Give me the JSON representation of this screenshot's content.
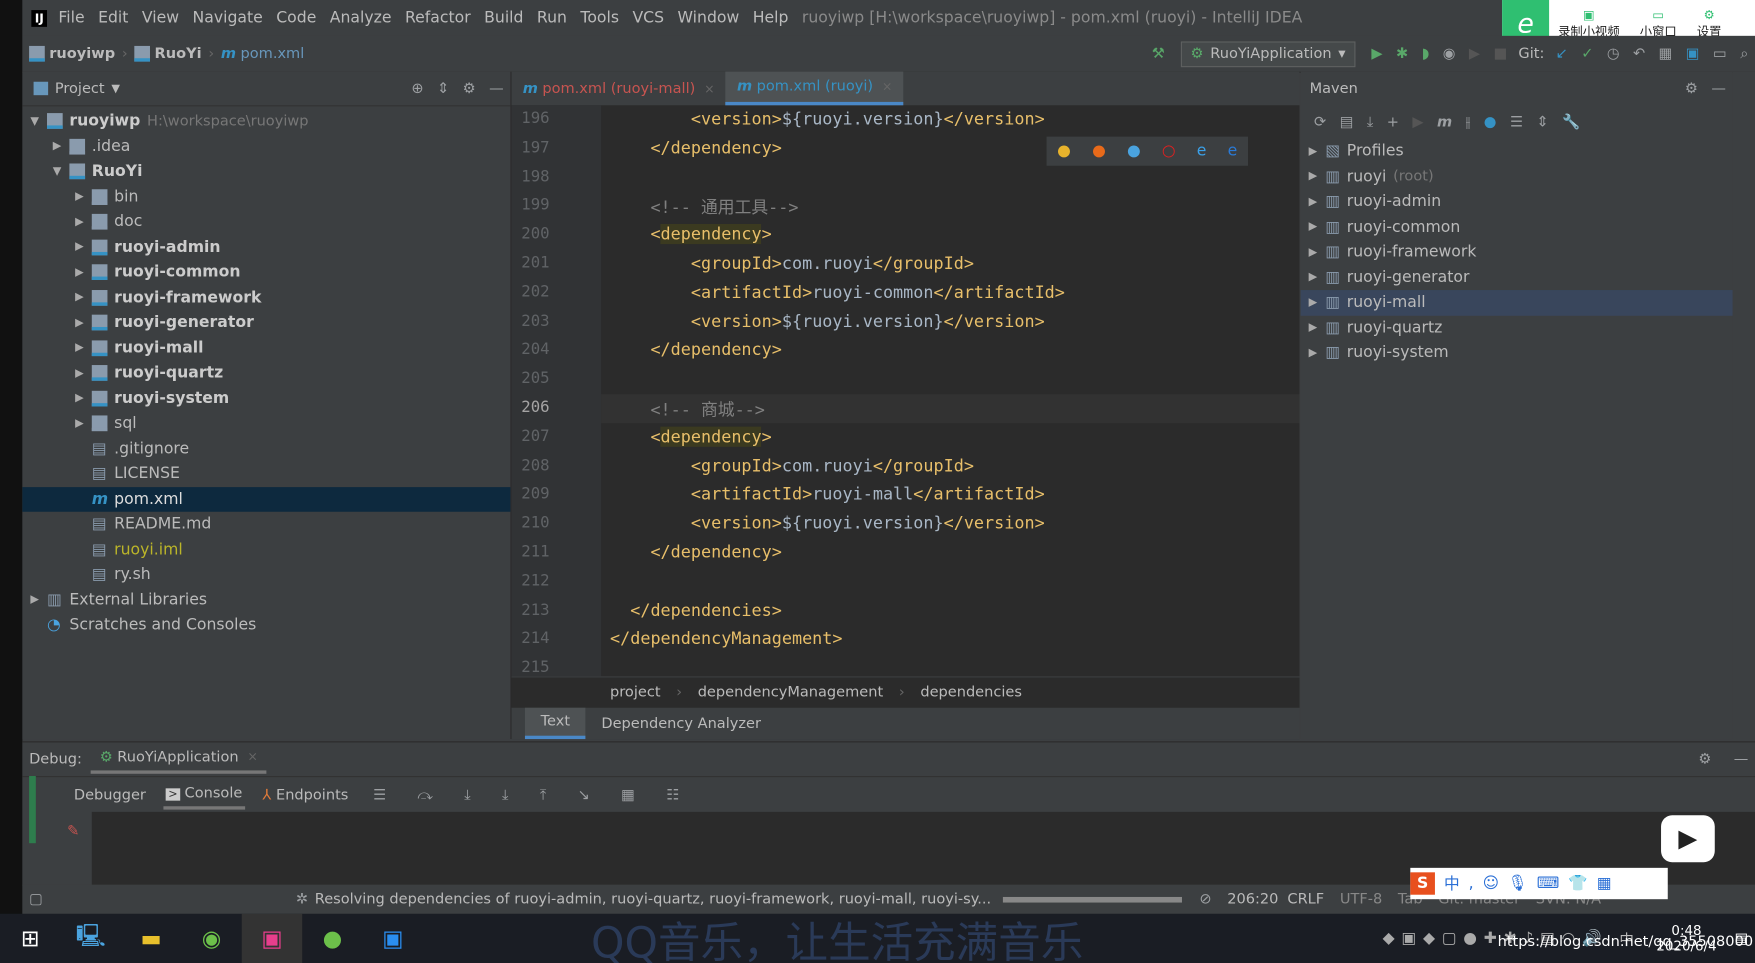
{
  "menubar": {
    "items": [
      "File",
      "Edit",
      "View",
      "Navigate",
      "Code",
      "Analyze",
      "Refactor",
      "Build",
      "Run",
      "Tools",
      "VCS",
      "Window",
      "Help"
    ],
    "title": "ruoyiwp [H:\\workspace\\ruoyiwp] - pom.xml (ruoyi) - IntelliJ IDEA"
  },
  "overlay": {
    "record": "录制小视频",
    "mini": "小窗口",
    "settings": "设置"
  },
  "navbar": {
    "crumbs": [
      "ruoyiwp",
      "RuoYi",
      "pom.xml"
    ],
    "run_config": "RuoYiApplication",
    "git": "Git:"
  },
  "project": {
    "title": "Project",
    "tree": [
      {
        "label": "ruoyiwp",
        "hint": "H:\\workspace\\ruoyiwp",
        "depth": 0,
        "arrow": "down",
        "type": "module",
        "bold": true
      },
      {
        "label": ".idea",
        "depth": 1,
        "arrow": "right",
        "type": "folder"
      },
      {
        "label": "RuoYi",
        "depth": 1,
        "arrow": "down",
        "type": "module",
        "bold": true
      },
      {
        "label": "bin",
        "depth": 2,
        "arrow": "right",
        "type": "folder"
      },
      {
        "label": "doc",
        "depth": 2,
        "arrow": "right",
        "type": "folder"
      },
      {
        "label": "ruoyi-admin",
        "depth": 2,
        "arrow": "right",
        "type": "module",
        "bold": true
      },
      {
        "label": "ruoyi-common",
        "depth": 2,
        "arrow": "right",
        "type": "module",
        "bold": true
      },
      {
        "label": "ruoyi-framework",
        "depth": 2,
        "arrow": "right",
        "type": "module",
        "bold": true
      },
      {
        "label": "ruoyi-generator",
        "depth": 2,
        "arrow": "right",
        "type": "module",
        "bold": true
      },
      {
        "label": "ruoyi-mall",
        "depth": 2,
        "arrow": "right",
        "type": "module",
        "bold": true
      },
      {
        "label": "ruoyi-quartz",
        "depth": 2,
        "arrow": "right",
        "type": "module",
        "bold": true
      },
      {
        "label": "ruoyi-system",
        "depth": 2,
        "arrow": "right",
        "type": "module",
        "bold": true
      },
      {
        "label": "sql",
        "depth": 2,
        "arrow": "right",
        "type": "folder"
      },
      {
        "label": ".gitignore",
        "depth": 2,
        "type": "file"
      },
      {
        "label": "LICENSE",
        "depth": 2,
        "type": "file"
      },
      {
        "label": "pom.xml",
        "depth": 2,
        "type": "maven",
        "selected": true
      },
      {
        "label": "README.md",
        "depth": 2,
        "type": "file"
      },
      {
        "label": "ruoyi.iml",
        "depth": 2,
        "type": "file",
        "color": "#bbb529"
      },
      {
        "label": "ry.sh",
        "depth": 2,
        "type": "file"
      },
      {
        "label": "External Libraries",
        "depth": 0,
        "arrow": "right",
        "type": "lib"
      },
      {
        "label": "Scratches and Consoles",
        "depth": 0,
        "type": "scratch"
      }
    ]
  },
  "editor": {
    "tabs": [
      {
        "label": "pom.xml (ruoyi-mall)",
        "color": "#c75450"
      },
      {
        "label": "pom.xml (ruoyi)",
        "color": "#3592c4",
        "active": true
      }
    ],
    "lines": [
      {
        "n": "196",
        "code": "        <version>${ruoyi.version}</version>"
      },
      {
        "n": "197",
        "code": "    </dependency>"
      },
      {
        "n": "198",
        "code": ""
      },
      {
        "n": "199",
        "code": "    <!-- 通用工具-->"
      },
      {
        "n": "200",
        "code": "    <dependency>"
      },
      {
        "n": "201",
        "code": "        <groupId>com.ruoyi</groupId>"
      },
      {
        "n": "202",
        "code": "        <artifactId>ruoyi-common</artifactId>"
      },
      {
        "n": "203",
        "code": "        <version>${ruoyi.version}</version>"
      },
      {
        "n": "204",
        "code": "    </dependency>"
      },
      {
        "n": "205",
        "code": ""
      },
      {
        "n": "206",
        "code": "    <!-- 商城-->"
      },
      {
        "n": "207",
        "code": "    <dependency>"
      },
      {
        "n": "208",
        "code": "        <groupId>com.ruoyi</groupId>"
      },
      {
        "n": "209",
        "code": "        <artifactId>ruoyi-mall</artifactId>"
      },
      {
        "n": "210",
        "code": "        <version>${ruoyi.version}</version>"
      },
      {
        "n": "211",
        "code": "    </dependency>"
      },
      {
        "n": "212",
        "code": ""
      },
      {
        "n": "213",
        "code": "  </dependencies>"
      },
      {
        "n": "214",
        "code": "</dependencyManagement>"
      },
      {
        "n": "215",
        "code": ""
      }
    ],
    "breadcrumb": [
      "project",
      "dependencyManagement",
      "dependencies"
    ],
    "bottom_tabs": [
      "Text",
      "Dependency Analyzer"
    ]
  },
  "maven": {
    "title": "Maven",
    "items": [
      {
        "label": "Profiles",
        "type": "profiles"
      },
      {
        "label": "ruoyi",
        "hint": "(root)"
      },
      {
        "label": "ruoyi-admin"
      },
      {
        "label": "ruoyi-common"
      },
      {
        "label": "ruoyi-framework"
      },
      {
        "label": "ruoyi-generator"
      },
      {
        "label": "ruoyi-mall",
        "selected": true
      },
      {
        "label": "ruoyi-quartz"
      },
      {
        "label": "ruoyi-system"
      }
    ]
  },
  "debug": {
    "label": "Debug:",
    "session": "RuoYiApplication",
    "tabs": [
      "Debugger",
      "Console",
      "Endpoints"
    ]
  },
  "status": {
    "message": "Resolving dependencies of ruoyi-admin, ruoyi-quartz, ruoyi-framework, ruoyi-mall, ruoyi-sy...",
    "position": "206:20",
    "line_sep": "CRLF",
    "encoding": "UTF-8",
    "indent": "Tab",
    "git": "Git: master",
    "svn": "SVN: N/A"
  },
  "taskbar": {
    "banner": "QQ音乐，让生活充满音乐",
    "time": "0:48",
    "date": "2020/6/4",
    "ime": "中",
    "watermark": "https://blog.csdn.net/qq_35508000"
  }
}
